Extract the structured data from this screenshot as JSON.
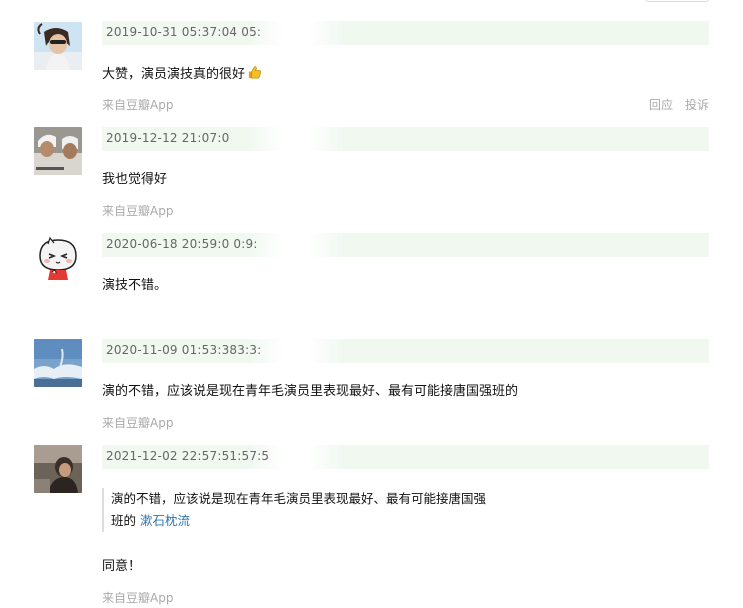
{
  "comments": [
    {
      "time": "2019-10-31 05:37:04 05:",
      "text": "大赞，演员演技真的很好",
      "source": "来自豆瓣App",
      "actions": {
        "reply": "回应",
        "report": "投诉"
      }
    },
    {
      "time": "2019-12-12 21:07:0",
      "text": "我也觉得好",
      "source": "来自豆瓣App"
    },
    {
      "time": "2020-06-18 20:59:0 0:9:",
      "text": "演技不错。"
    },
    {
      "time": "2020-11-09 01:53:383:3:",
      "text": "演的不错，应该说是现在青年毛演员里表现最好、最有可能接唐国强班的",
      "source": "来自豆瓣App"
    },
    {
      "time": "2021-12-02 22:57:51:57:5",
      "quote": {
        "text_line1": "演的不错，应该说是现在青年毛演员里表现最好、最有可能接唐国强",
        "text_line2": "班的",
        "author": "漱石枕流"
      },
      "text": "同意！",
      "source": "来自豆瓣App"
    }
  ]
}
